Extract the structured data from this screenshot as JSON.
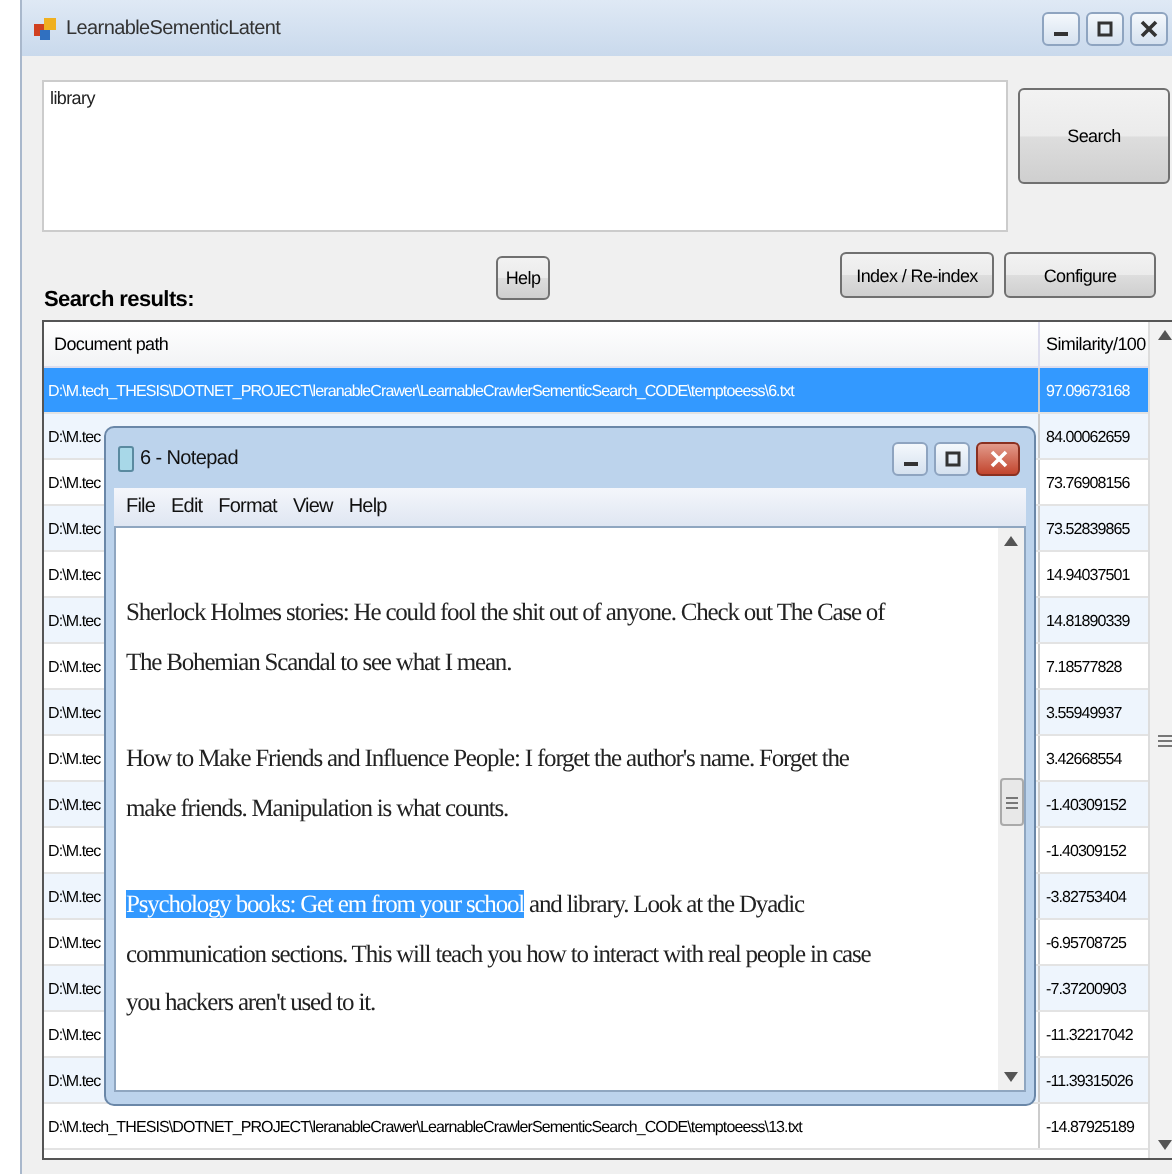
{
  "window": {
    "title": "LearnableSementicLatent"
  },
  "query": {
    "value": "library"
  },
  "buttons": {
    "search": "Search",
    "help": "Help",
    "index": "Index / Re-index",
    "configure": "Configure"
  },
  "results_label": "Search results:",
  "table": {
    "columns": [
      "Document path",
      "Similarity/100"
    ],
    "rows": [
      {
        "path": "D:\\M.tech_THESIS\\DOTNET_PROJECT\\leranableCrawer\\LearnableCrawlerSementicSearch_CODE\\temptoeess\\6.txt",
        "similarity": "97.09673168",
        "selected": true
      },
      {
        "path": "D:\\M.tec",
        "similarity": "84.00062659",
        "selected": false
      },
      {
        "path": "D:\\M.tec",
        "similarity": "73.76908156",
        "selected": false
      },
      {
        "path": "D:\\M.tec",
        "similarity": "73.52839865",
        "selected": false
      },
      {
        "path": "D:\\M.tec",
        "similarity": "14.94037501",
        "selected": false
      },
      {
        "path": "D:\\M.tec",
        "similarity": "14.81890339",
        "selected": false
      },
      {
        "path": "D:\\M.tec",
        "similarity": "7.18577828",
        "selected": false
      },
      {
        "path": "D:\\M.tec",
        "similarity": "3.55949937",
        "selected": false
      },
      {
        "path": "D:\\M.tec",
        "similarity": "3.42668554",
        "selected": false
      },
      {
        "path": "D:\\M.tec",
        "similarity": "-1.40309152",
        "selected": false
      },
      {
        "path": "D:\\M.tec",
        "similarity": "-1.40309152",
        "selected": false
      },
      {
        "path": "D:\\M.tec",
        "similarity": "-3.82753404",
        "selected": false
      },
      {
        "path": "D:\\M.tec",
        "similarity": "-6.95708725",
        "selected": false
      },
      {
        "path": "D:\\M.tec",
        "similarity": "-7.37200903",
        "selected": false
      },
      {
        "path": "D:\\M.tec",
        "similarity": "-11.32217042",
        "selected": false
      },
      {
        "path": "D:\\M.tec",
        "similarity": "-11.39315026",
        "selected": false
      },
      {
        "path": "D:\\M.tech_THESIS\\DOTNET_PROJECT\\leranableCrawer\\LearnableCrawlerSementicSearch_CODE\\temptoeess\\13.txt",
        "similarity": "-14.87925189",
        "selected": false
      }
    ]
  },
  "notepad": {
    "title": "6 - Notepad",
    "menu": [
      "File",
      "Edit",
      "Format",
      "View",
      "Help"
    ],
    "paragraphs": [
      {
        "lines": [
          "Sherlock Holmes stories: He could fool the shit out of anyone. Check out The Case of",
          "The Bohemian Scandal to see what I mean."
        ]
      },
      {
        "lines": [
          "How to Make Friends and Influence People: I forget the author's name. Forget the",
          "make friends. Manipulation is what counts."
        ]
      },
      {
        "selection": "Psychology books: Get em from your school",
        "lines": [
          " and library. Look at the Dyadic",
          "communication sections. This will teach you how to interact with real people in case",
          "you hackers aren't used to it."
        ]
      }
    ]
  }
}
